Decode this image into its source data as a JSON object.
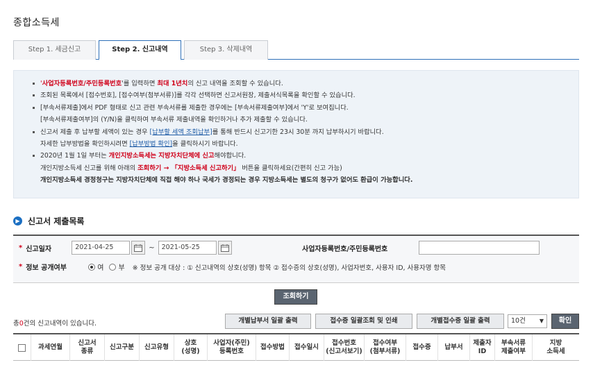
{
  "page": {
    "title": "종합소득세"
  },
  "tabs": [
    {
      "label": "Step 1. 세금신고"
    },
    {
      "label": "Step 2. 신고내역"
    },
    {
      "label": "Step 3. 삭제내역"
    }
  ],
  "notice": {
    "l1a": "'",
    "l1b": "사업자등록번호/주민등록번호",
    "l1c": "'를 입력하면 ",
    "l1d": "최대 1년치",
    "l1e": "의 신고 내역을 조회할 수 있습니다.",
    "l2": "조회된 목록에서 [접수번호], [접수여부(첨부서류)]를 각각 선택하면 신고서원장, 제출서식목록을 확인할 수 있습니다.",
    "l3": "[부속서류제출]에서 PDF 형태로 신고 관련 부속서류를 제출한 경우에는 [부속서류제출여부]에서 'Y'로 보여집니다.",
    "l4": "[부속서류제출여부]의 (Y/N)을 클릭하여 부속서류 제출내역을 확인하거나 추가 제출할 수 있습니다.",
    "l5a": "신고서 제출 후 납부할 세액이 있는 경우 ",
    "l5b": "[납부할 세액 조회납부]",
    "l5c": "를 통해 반드시 신고기한 23시 30분 까지 납부하시기 바랍니다.",
    "l6a": "자세한 납부방법을 확인하시려면 ",
    "l6b": "[납부방법 확인]",
    "l6c": "을 클릭하시기 바랍니다.",
    "l7a": "2020년 1월 1일 부터는 ",
    "l7b": "개인지방소득세는 지방자치단체에 신고",
    "l7c": "해야합니다.",
    "l8a": "개인지방소득세 신고를 위해 아래의 ",
    "l8b": "조회하기 → 「지방소득세 신고하기」",
    "l8c": " 버튼을 클릭하세요(간편히 신고 가능)",
    "l9": "개인지방소득세 경정청구는 지방자치단체에 직접 해야 하나 국세가 경정되는 경우 지방소득세는 별도의 청구가 없어도 환급이 가능합니다."
  },
  "section": {
    "title": "신고서 제출목록"
  },
  "search": {
    "date_label": "신고일자",
    "date_from": "2021-04-25",
    "date_to": "2021-05-25",
    "tilde": "~",
    "biz_label": "사업자등록번호/주민등록번호",
    "disclose_label": "정보 공개여부",
    "yes": "여",
    "no": "부",
    "note": "※ 정보 공개 대상 : ① 신고내역의 상호(성명) 항목 ② 접수증의 상호(성명), 사업자번호, 사용자 ID, 사용자명 항목",
    "submit": "조회하기"
  },
  "result": {
    "count_prefix": "총",
    "count": "0",
    "count_suffix": "건의 신고내역이 있습니다.",
    "btn_bulk_pay": "개별납부서 일괄 출력",
    "btn_receipt": "접수증 일괄조회 및 인쇄",
    "btn_bulk_receipt": "개별접수증 일괄 출력",
    "page_size": "10건",
    "ok": "확인"
  },
  "table": {
    "headers": [
      "과세연월",
      "신고서\n종류",
      "신고구분",
      "신고유형",
      "상호\n(성명)",
      "사업자(주민)\n등록번호",
      "접수방법",
      "접수일시",
      "접수번호\n(신고서보기)",
      "접수여부\n(첨부서류)",
      "접수증",
      "납부서",
      "제출자\nID",
      "부속서류\n제출여부",
      "지방\n소득세"
    ]
  },
  "colors": {
    "accent": "#2d6fb8",
    "danger": "#d0021b",
    "notice_bg": "#eef3f8",
    "button_dark": "#5a6470"
  }
}
